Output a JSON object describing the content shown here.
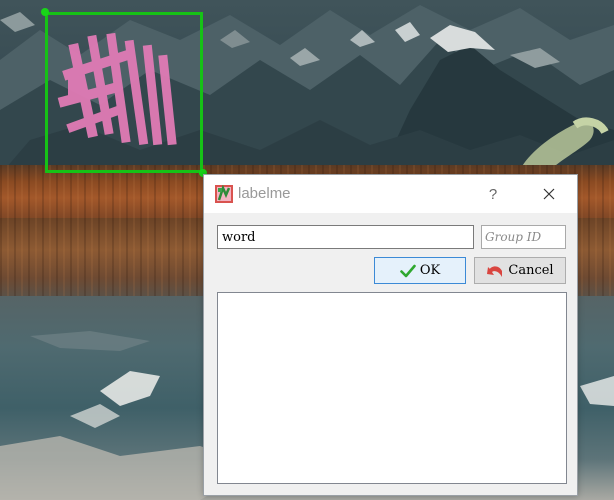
{
  "dialog": {
    "title": "labelme",
    "help_glyph": "?",
    "label_input": {
      "value": "word",
      "placeholder": ""
    },
    "group_input": {
      "value": "",
      "placeholder": "Group ID"
    },
    "ok_label": "OK",
    "cancel_label": "Cancel",
    "label_list": []
  },
  "annotation": {
    "shape": "rectangle",
    "color": "#16c216",
    "selected": true
  },
  "icons": {
    "app": "labelme-app-icon",
    "help": "help-icon",
    "close": "close-icon",
    "ok": "checkmark-icon",
    "cancel": "undo-arrow-icon"
  },
  "colors": {
    "annotation_border": "#16c216",
    "ok_border": "#3c8ad6",
    "ok_fill": "#e5f1fb",
    "dialog_bg": "#f0f0f0"
  }
}
